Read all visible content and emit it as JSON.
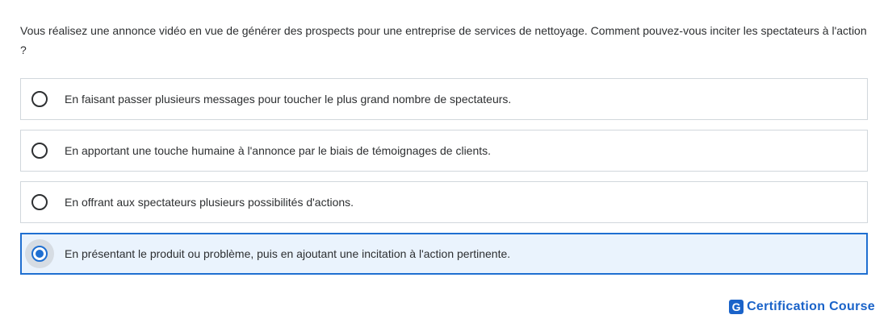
{
  "question": {
    "text": "Vous réalisez une annonce vidéo en vue de générer des prospects pour une entreprise de services de nettoyage. Comment pouvez-vous inciter les spectateurs à l'action ?"
  },
  "options": [
    {
      "label": "En faisant passer plusieurs messages pour toucher le plus grand nombre de spectateurs.",
      "selected": false
    },
    {
      "label": "En apportant une touche humaine à l'annonce par le biais de témoignages de clients.",
      "selected": false
    },
    {
      "label": "En offrant aux spectateurs plusieurs possibilités d'actions.",
      "selected": false
    },
    {
      "label": "En présentant le produit ou problème, puis en ajoutant une incitation à l'action pertinente.",
      "selected": true
    }
  ],
  "brand": {
    "logo_letter": "G",
    "name": "Certification Course"
  },
  "colors": {
    "accent": "#1f6fd1",
    "selected_bg": "#eaf3fd",
    "border": "#d1d7dc",
    "brand": "#1a63c9"
  },
  "icons": {
    "radio_unchecked": "radio-unchecked-icon",
    "radio_checked": "radio-checked-icon",
    "brand_logo": "g-logo-icon"
  }
}
